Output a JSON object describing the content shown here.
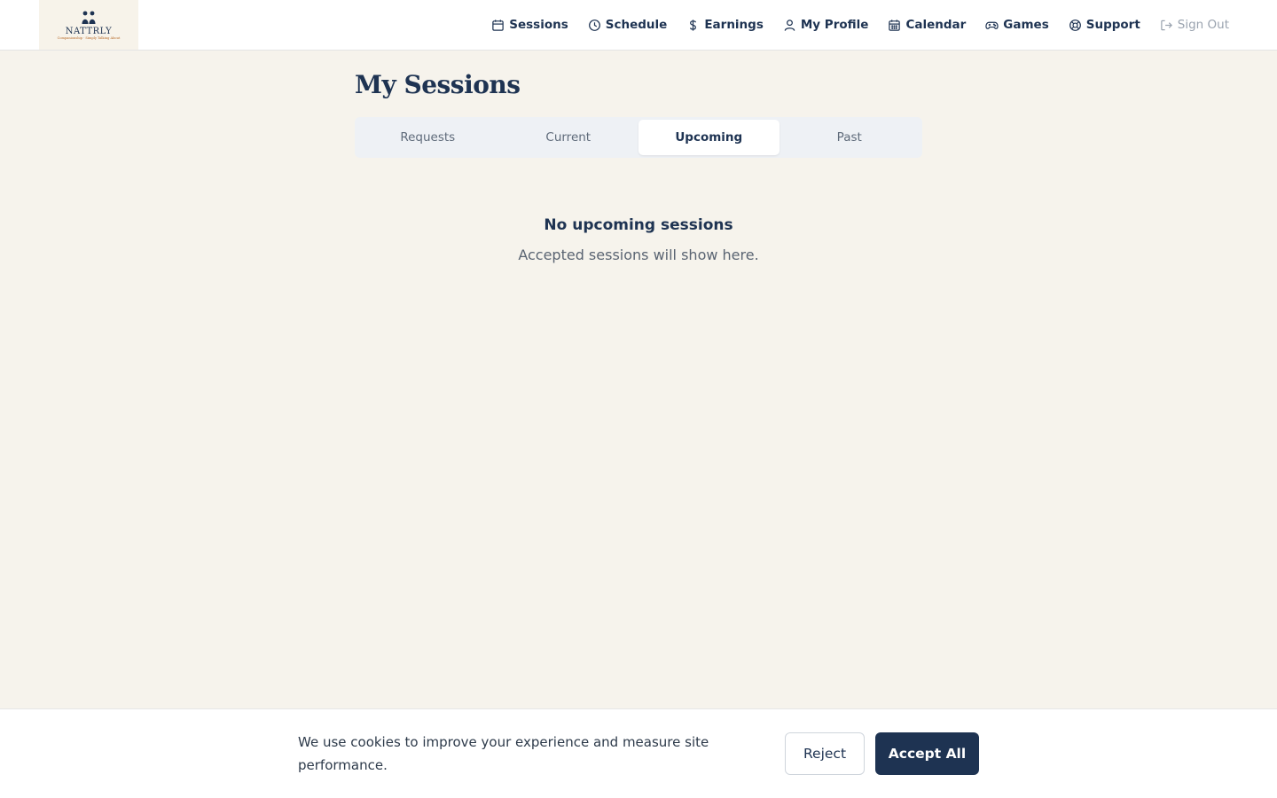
{
  "brand": {
    "name": "NATTRLY",
    "tagline": "Companionship · Simply Talking About"
  },
  "nav": {
    "items": [
      {
        "label": "Sessions",
        "icon": "calendar-icon"
      },
      {
        "label": "Schedule",
        "icon": "clock-icon"
      },
      {
        "label": "Earnings",
        "icon": "dollar-icon"
      },
      {
        "label": "My Profile",
        "icon": "user-icon"
      },
      {
        "label": "Calendar",
        "icon": "calendar-grid-icon"
      },
      {
        "label": "Games",
        "icon": "gamepad-icon"
      },
      {
        "label": "Support",
        "icon": "lifebuoy-icon"
      },
      {
        "label": "Sign Out",
        "icon": "sign-out-icon"
      }
    ]
  },
  "main": {
    "title": "My Sessions",
    "tabs": [
      {
        "label": "Requests",
        "active": false
      },
      {
        "label": "Current",
        "active": false
      },
      {
        "label": "Upcoming",
        "active": true
      },
      {
        "label": "Past",
        "active": false
      }
    ],
    "empty_state": {
      "title": "No upcoming sessions",
      "subtitle": "Accepted sessions will show here."
    }
  },
  "cookie_banner": {
    "text": "We use cookies to improve your experience and measure site performance.",
    "reject_label": "Reject",
    "accept_label": "Accept All"
  },
  "colors": {
    "primary": "#1e3352",
    "background": "#f6f3ec",
    "muted": "#9aa3af"
  }
}
